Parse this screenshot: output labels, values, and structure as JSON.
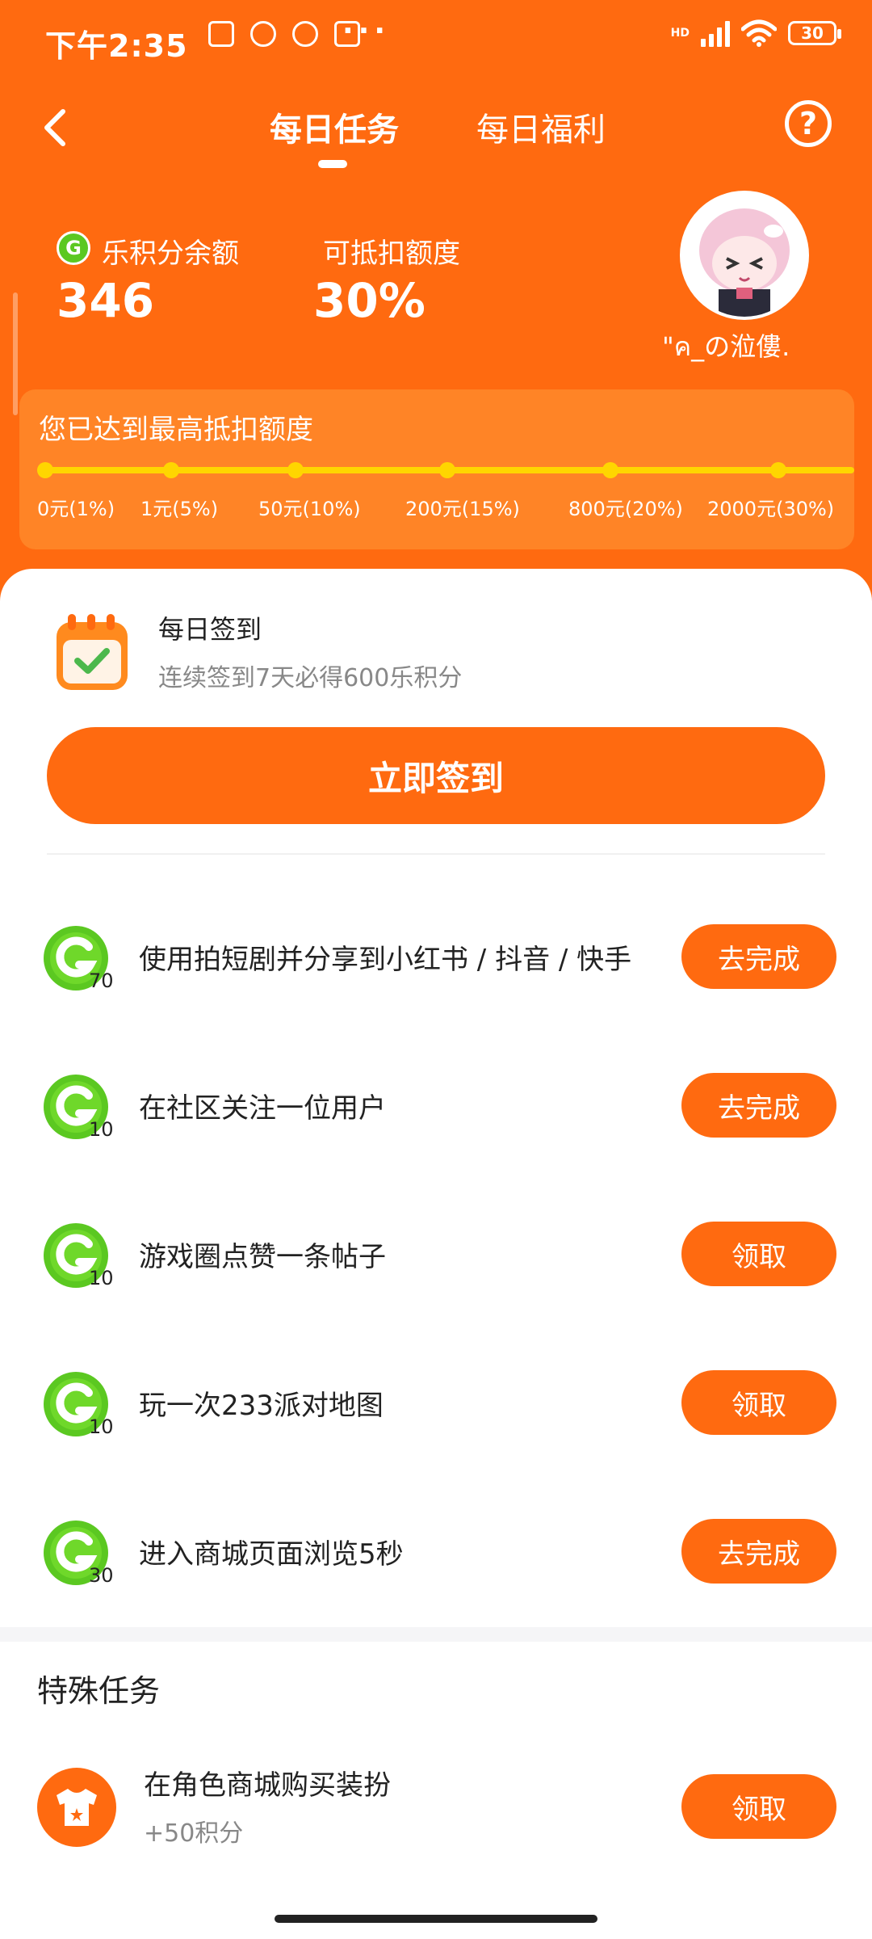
{
  "status_bar": {
    "time": "下午2:35",
    "network": "HD",
    "battery": "30",
    "more": "···"
  },
  "header": {
    "tabs": [
      {
        "label": "每日任务",
        "active": true
      },
      {
        "label": "每日福利",
        "active": false
      }
    ],
    "help_label": "?"
  },
  "stats": {
    "balance_label": "乐积分余额",
    "balance_value": "346",
    "deduct_label": "可抵扣额度",
    "deduct_value": "30%",
    "username": "\"ค_の涖僂."
  },
  "progress": {
    "title": "您已达到最高抵扣额度",
    "ticks": [
      "0元(1%)",
      "1元(5%)",
      "50元(10%)",
      "200元(15%)",
      "800元(20%)",
      "2000元(30%)"
    ]
  },
  "daily_sign": {
    "title": "每日签到",
    "subtitle": "连续签到7天必得600乐积分",
    "button": "立即签到"
  },
  "tasks": [
    {
      "points": "70",
      "label": "使用拍短剧并分享到小红书 / 抖音 / 快手",
      "button": "去完成"
    },
    {
      "points": "10",
      "label": "在社区关注一位用户",
      "button": "去完成"
    },
    {
      "points": "10",
      "label": "游戏圈点赞一条帖子",
      "button": "领取"
    },
    {
      "points": "10",
      "label": "玩一次233派对地图",
      "button": "领取"
    },
    {
      "points": "30",
      "label": "进入商城页面浏览5秒",
      "button": "去完成"
    }
  ],
  "special": {
    "title": "特殊任务",
    "item_label": "在角色商城购买装扮",
    "item_sub": "+50积分",
    "button": "领取"
  },
  "colors": {
    "brand": "#ff6a10",
    "progress": "#ffd600",
    "coin": "#5bc821"
  }
}
